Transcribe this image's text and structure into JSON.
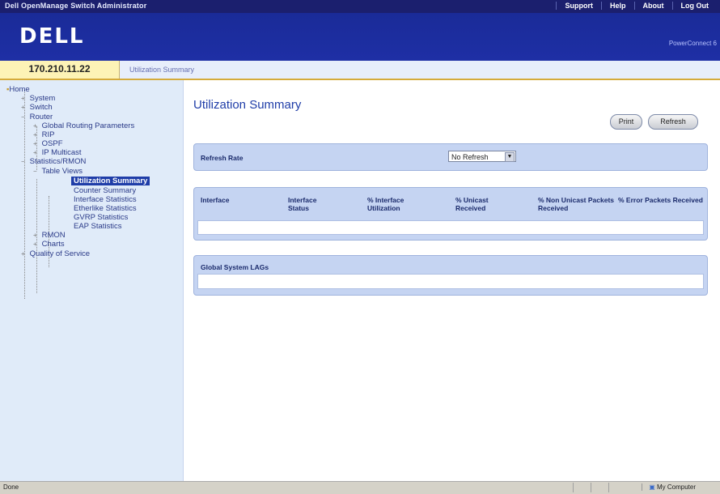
{
  "header": {
    "app_title": "Dell OpenManage Switch Administrator",
    "links": [
      "Support",
      "Help",
      "About",
      "Log Out"
    ],
    "logo": "DELL",
    "brand": "PowerConnect 6"
  },
  "address": {
    "ip": "170.210.11.22",
    "breadcrumb": "Utilization Summary"
  },
  "tree": {
    "items": [
      {
        "label": "Home"
      },
      {
        "label": "System"
      },
      {
        "label": "Switch"
      },
      {
        "label": "Router"
      },
      {
        "label": "Global Routing Parameters"
      },
      {
        "label": "RIP"
      },
      {
        "label": "OSPF"
      },
      {
        "label": "IP Multicast"
      },
      {
        "label": "Statistics/RMON"
      },
      {
        "label": "Table Views"
      },
      {
        "label": "Utilization Summary"
      },
      {
        "label": "Counter Summary"
      },
      {
        "label": "Interface Statistics"
      },
      {
        "label": "Etherlike Statistics"
      },
      {
        "label": "GVRP Statistics"
      },
      {
        "label": "EAP Statistics"
      },
      {
        "label": "RMON"
      },
      {
        "label": "Charts"
      },
      {
        "label": "Quality of Service"
      }
    ]
  },
  "main": {
    "title": "Utilization Summary",
    "print_label": "Print",
    "refresh_label": "Refresh",
    "refresh_rate_label": "Refresh Rate",
    "refresh_rate_value": "No Refresh",
    "columns": [
      "Interface",
      "Interface Status",
      "% Interface Utilization",
      "% Unicast Received",
      "% Non Unicast Packets Received",
      "% Error Packets Received"
    ],
    "lag_label": "Global System LAGs"
  },
  "status": {
    "left": "Done",
    "zone": "My Computer"
  }
}
